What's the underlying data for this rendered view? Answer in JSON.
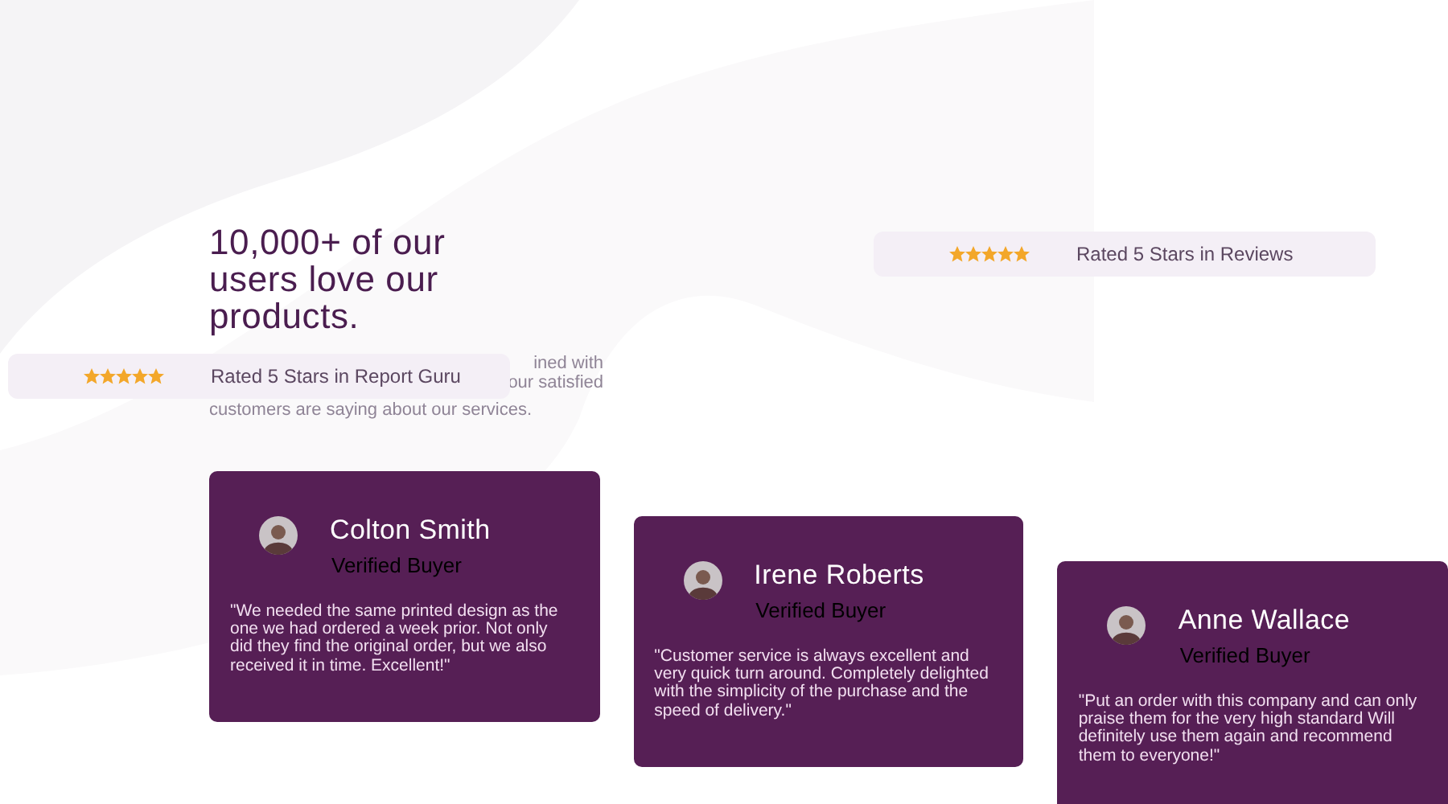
{
  "heading": "10,000+ of our users love our products.",
  "intro_lines": [
    "ined with",
    "our satisfied",
    "customers are saying about our services."
  ],
  "ratings": [
    {
      "stars": 5,
      "text": "Rated 5 Stars in Report Guru"
    },
    {
      "stars": 5,
      "text": "Rated 5 Stars in Reviews"
    }
  ],
  "reviews": [
    {
      "name": "Colton Smith",
      "badge": "Verified Buyer",
      "quote": "\"We needed the same printed design as the one we had ordered a week prior. Not only did they find the original order, but we also received it in time. Excellent!\""
    },
    {
      "name": "Irene Roberts",
      "badge": "Verified Buyer",
      "quote": "\"Customer service is always excellent and very quick turn around. Completely delighted with the simplicity of the purchase and the speed of delivery.\""
    },
    {
      "name": "Anne Wallace",
      "badge": "Verified Buyer",
      "quote": "\"Put an order with this company and can only praise them for the very high standard Will definitely use them again and recommend them to everyone!\""
    }
  ]
}
